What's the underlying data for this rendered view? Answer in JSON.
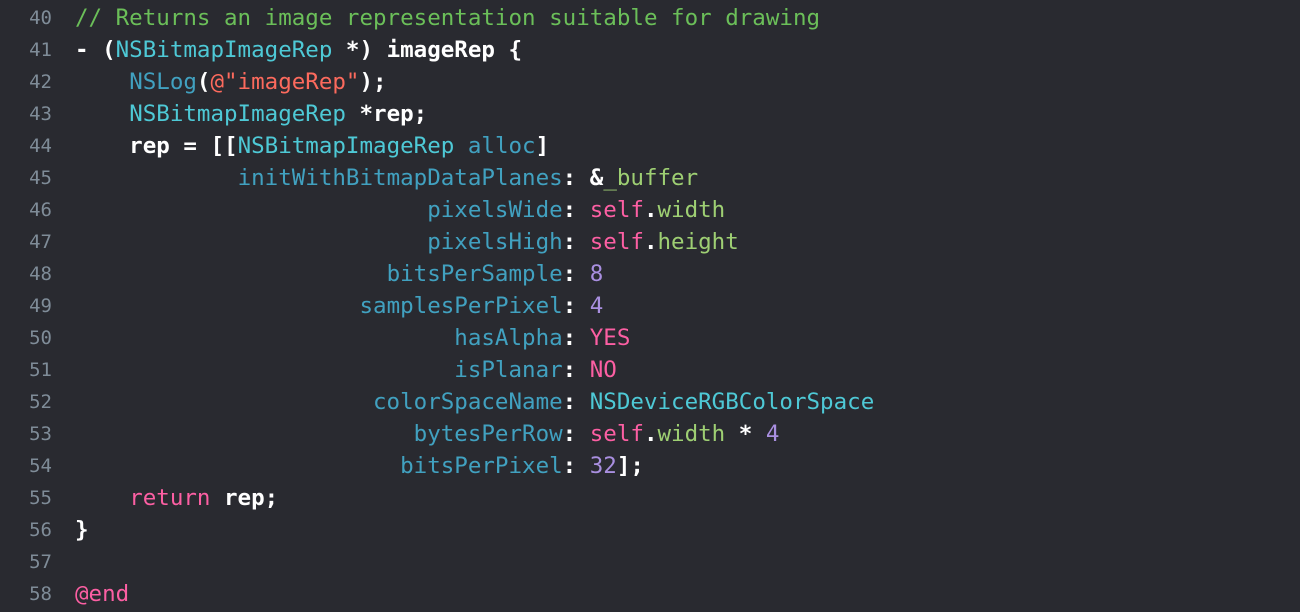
{
  "editor": {
    "lines": [
      {
        "num": "40",
        "tokens": [
          {
            "t": "// Returns an image representation suitable for drawing",
            "k": "comment"
          }
        ]
      },
      {
        "num": "41",
        "tokens": [
          {
            "t": "- (",
            "k": "plain"
          },
          {
            "t": "NSBitmapImageRep",
            "k": "type"
          },
          {
            "t": " *) imageRep {",
            "k": "plain"
          }
        ]
      },
      {
        "num": "42",
        "tokens": [
          {
            "t": "    ",
            "k": "plain"
          },
          {
            "t": "NSLog",
            "k": "func"
          },
          {
            "t": "(",
            "k": "plain"
          },
          {
            "t": "@\"imageRep\"",
            "k": "string"
          },
          {
            "t": ");",
            "k": "plain"
          }
        ]
      },
      {
        "num": "43",
        "tokens": [
          {
            "t": "    ",
            "k": "plain"
          },
          {
            "t": "NSBitmapImageRep",
            "k": "type"
          },
          {
            "t": " *rep;",
            "k": "plain"
          }
        ]
      },
      {
        "num": "44",
        "tokens": [
          {
            "t": "    rep = [[",
            "k": "plain"
          },
          {
            "t": "NSBitmapImageRep",
            "k": "type"
          },
          {
            "t": " ",
            "k": "plain"
          },
          {
            "t": "alloc",
            "k": "func"
          },
          {
            "t": "]",
            "k": "plain"
          }
        ]
      },
      {
        "num": "45",
        "tokens": [
          {
            "t": "            ",
            "k": "plain"
          },
          {
            "t": "initWithBitmapDataPlanes",
            "k": "param"
          },
          {
            "t": ": &",
            "k": "plain"
          },
          {
            "t": "_buffer",
            "k": "ivar"
          }
        ]
      },
      {
        "num": "46",
        "tokens": [
          {
            "t": "                          ",
            "k": "plain"
          },
          {
            "t": "pixelsWide",
            "k": "param"
          },
          {
            "t": ": ",
            "k": "plain"
          },
          {
            "t": "self",
            "k": "keyword"
          },
          {
            "t": ".",
            "k": "plain"
          },
          {
            "t": "width",
            "k": "prop"
          }
        ]
      },
      {
        "num": "47",
        "tokens": [
          {
            "t": "                          ",
            "k": "plain"
          },
          {
            "t": "pixelsHigh",
            "k": "param"
          },
          {
            "t": ": ",
            "k": "plain"
          },
          {
            "t": "self",
            "k": "keyword"
          },
          {
            "t": ".",
            "k": "plain"
          },
          {
            "t": "height",
            "k": "prop"
          }
        ]
      },
      {
        "num": "48",
        "tokens": [
          {
            "t": "                       ",
            "k": "plain"
          },
          {
            "t": "bitsPerSample",
            "k": "param"
          },
          {
            "t": ": ",
            "k": "plain"
          },
          {
            "t": "8",
            "k": "number"
          }
        ]
      },
      {
        "num": "49",
        "tokens": [
          {
            "t": "                     ",
            "k": "plain"
          },
          {
            "t": "samplesPerPixel",
            "k": "param"
          },
          {
            "t": ": ",
            "k": "plain"
          },
          {
            "t": "4",
            "k": "number"
          }
        ]
      },
      {
        "num": "50",
        "tokens": [
          {
            "t": "                            ",
            "k": "plain"
          },
          {
            "t": "hasAlpha",
            "k": "param"
          },
          {
            "t": ": ",
            "k": "plain"
          },
          {
            "t": "YES",
            "k": "const"
          }
        ]
      },
      {
        "num": "51",
        "tokens": [
          {
            "t": "                            ",
            "k": "plain"
          },
          {
            "t": "isPlanar",
            "k": "param"
          },
          {
            "t": ": ",
            "k": "plain"
          },
          {
            "t": "NO",
            "k": "const"
          }
        ]
      },
      {
        "num": "52",
        "tokens": [
          {
            "t": "                      ",
            "k": "plain"
          },
          {
            "t": "colorSpaceName",
            "k": "param"
          },
          {
            "t": ": ",
            "k": "plain"
          },
          {
            "t": "NSDeviceRGBColorSpace",
            "k": "macro"
          }
        ]
      },
      {
        "num": "53",
        "tokens": [
          {
            "t": "                         ",
            "k": "plain"
          },
          {
            "t": "bytesPerRow",
            "k": "param"
          },
          {
            "t": ": ",
            "k": "plain"
          },
          {
            "t": "self",
            "k": "keyword"
          },
          {
            "t": ".",
            "k": "plain"
          },
          {
            "t": "width",
            "k": "prop"
          },
          {
            "t": " * ",
            "k": "plain"
          },
          {
            "t": "4",
            "k": "number"
          }
        ]
      },
      {
        "num": "54",
        "tokens": [
          {
            "t": "                        ",
            "k": "plain"
          },
          {
            "t": "bitsPerPixel",
            "k": "param"
          },
          {
            "t": ": ",
            "k": "plain"
          },
          {
            "t": "32",
            "k": "number"
          },
          {
            "t": "];",
            "k": "plain"
          }
        ]
      },
      {
        "num": "55",
        "tokens": [
          {
            "t": "    ",
            "k": "plain"
          },
          {
            "t": "return",
            "k": "keyword"
          },
          {
            "t": " rep;",
            "k": "plain"
          }
        ]
      },
      {
        "num": "56",
        "tokens": [
          {
            "t": "}",
            "k": "plain"
          }
        ]
      },
      {
        "num": "57",
        "tokens": []
      },
      {
        "num": "58",
        "tokens": [
          {
            "t": "@end",
            "k": "keyword"
          }
        ]
      }
    ]
  },
  "colors": {
    "background": "#292a30",
    "line_number": "#7f8c98",
    "comment": "#6bbf59",
    "type": "#4ec9d6",
    "string": "#fc6a5d",
    "keyword": "#fc5fa3",
    "number": "#a98fe0",
    "ivar": "#9ecf73"
  }
}
